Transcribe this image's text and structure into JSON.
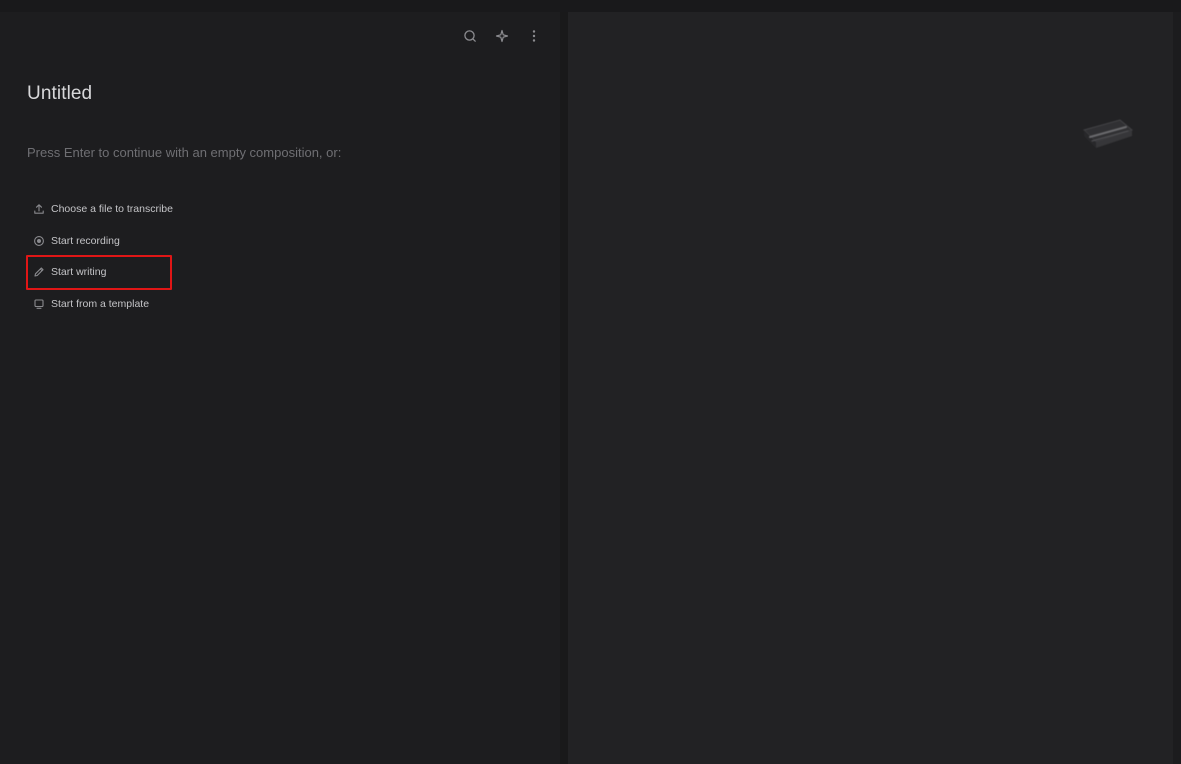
{
  "document": {
    "title": "Untitled",
    "hint": "Press Enter to continue with an empty composition, or:"
  },
  "toolbar": {
    "icons": [
      "search-icon",
      "sparkle-icon",
      "more-vertical-icon"
    ]
  },
  "options": [
    {
      "label": "Choose a file to transcribe",
      "icon": "upload-icon"
    },
    {
      "label": "Start recording",
      "icon": "record-icon"
    },
    {
      "label": "Start writing",
      "icon": "pencil-icon",
      "highlighted": true
    },
    {
      "label": "Start from a template",
      "icon": "template-icon"
    }
  ],
  "colors": {
    "highlight_box": "#e01616",
    "left_pane_bg": "#1d1d1f",
    "right_pane_bg": "#222224"
  }
}
